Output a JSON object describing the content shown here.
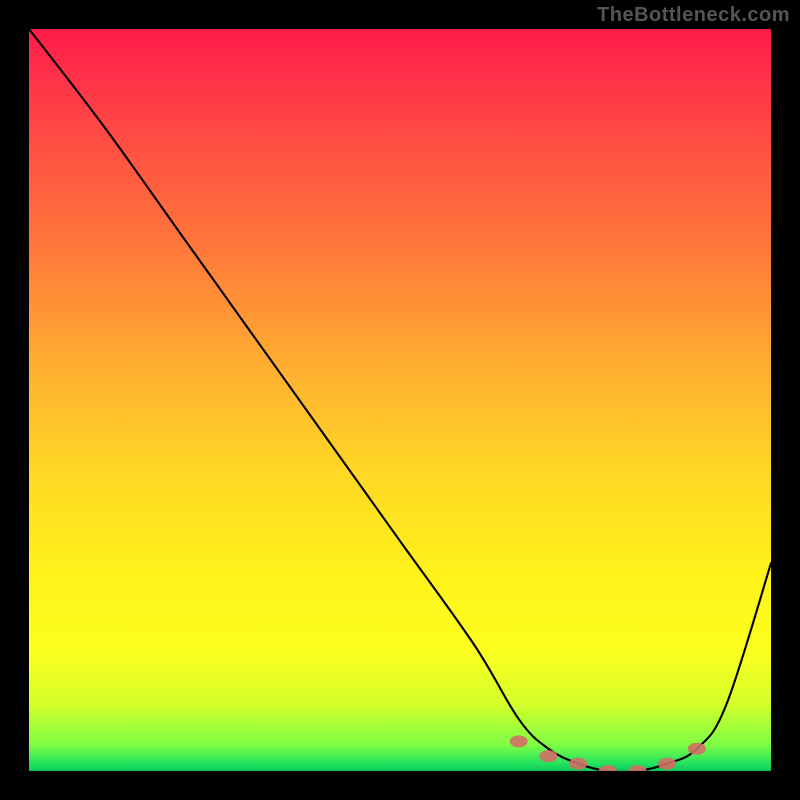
{
  "watermark": "TheBottleneck.com",
  "chart_data": {
    "type": "line",
    "title": "",
    "xlabel": "",
    "ylabel": "",
    "xlim": [
      0,
      100
    ],
    "ylim": [
      0,
      100
    ],
    "series": [
      {
        "name": "bottleneck-curve",
        "x": [
          0,
          10,
          20,
          30,
          40,
          50,
          60,
          66,
          70,
          74,
          78,
          82,
          86,
          90,
          94,
          100
        ],
        "values": [
          100,
          87,
          73,
          59,
          45,
          31,
          17,
          7,
          3,
          1,
          0,
          0,
          1,
          3,
          9,
          28
        ]
      }
    ],
    "markers": {
      "name": "sweet-spot-dots",
      "style": "pink-dots",
      "x": [
        66,
        70,
        74,
        78,
        82,
        86,
        90
      ],
      "values": [
        4,
        2,
        1,
        0,
        0,
        1,
        3
      ]
    },
    "background_gradient": {
      "from": "#ff1c4a",
      "through": [
        "#ffb030",
        "#fff31a"
      ],
      "to": "#08c95a"
    }
  }
}
